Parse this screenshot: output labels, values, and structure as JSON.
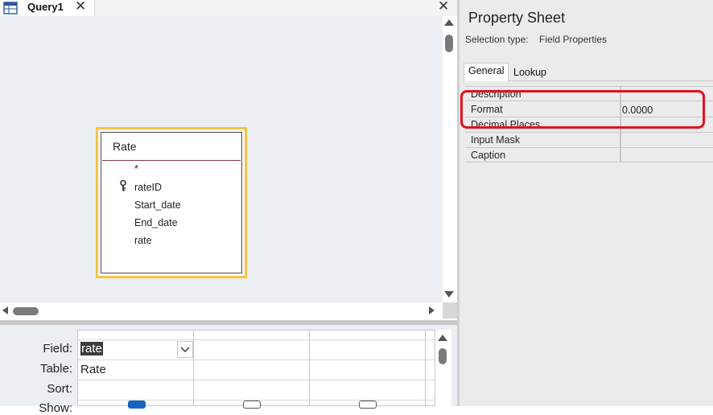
{
  "query_window": {
    "tab_title": "Query1",
    "tab_icon": "query-design-icon",
    "close_glyph": "✕"
  },
  "table_box": {
    "title": "Rate",
    "fields": [
      "*",
      "rateID",
      "Start_date",
      "End_date",
      "rate"
    ],
    "primary_key_field": "rateID",
    "key_icon": "key-icon"
  },
  "qbe_grid": {
    "row_labels": [
      "Field:",
      "Table:",
      "Sort:",
      "Show:"
    ],
    "column1": {
      "field": "rate",
      "table": "Rate",
      "show": true
    },
    "column2": {
      "show": false
    },
    "column3": {
      "show": false
    }
  },
  "property_sheet": {
    "title": "Property Sheet",
    "selection_type_label": "Selection type:",
    "selection_type_value": "Field Properties",
    "tabs": [
      "General",
      "Lookup"
    ],
    "active_tab": "General",
    "properties": [
      {
        "name": "Description",
        "value": ""
      },
      {
        "name": "Format",
        "value": "0.0000"
      },
      {
        "name": "Decimal Places",
        "value": ""
      },
      {
        "name": "Input Mask",
        "value": ""
      },
      {
        "name": "Caption",
        "value": ""
      }
    ]
  },
  "colors": {
    "table_highlight": "#f6c347",
    "annotation": "#e3111f",
    "selected_show": "#1565c0"
  }
}
